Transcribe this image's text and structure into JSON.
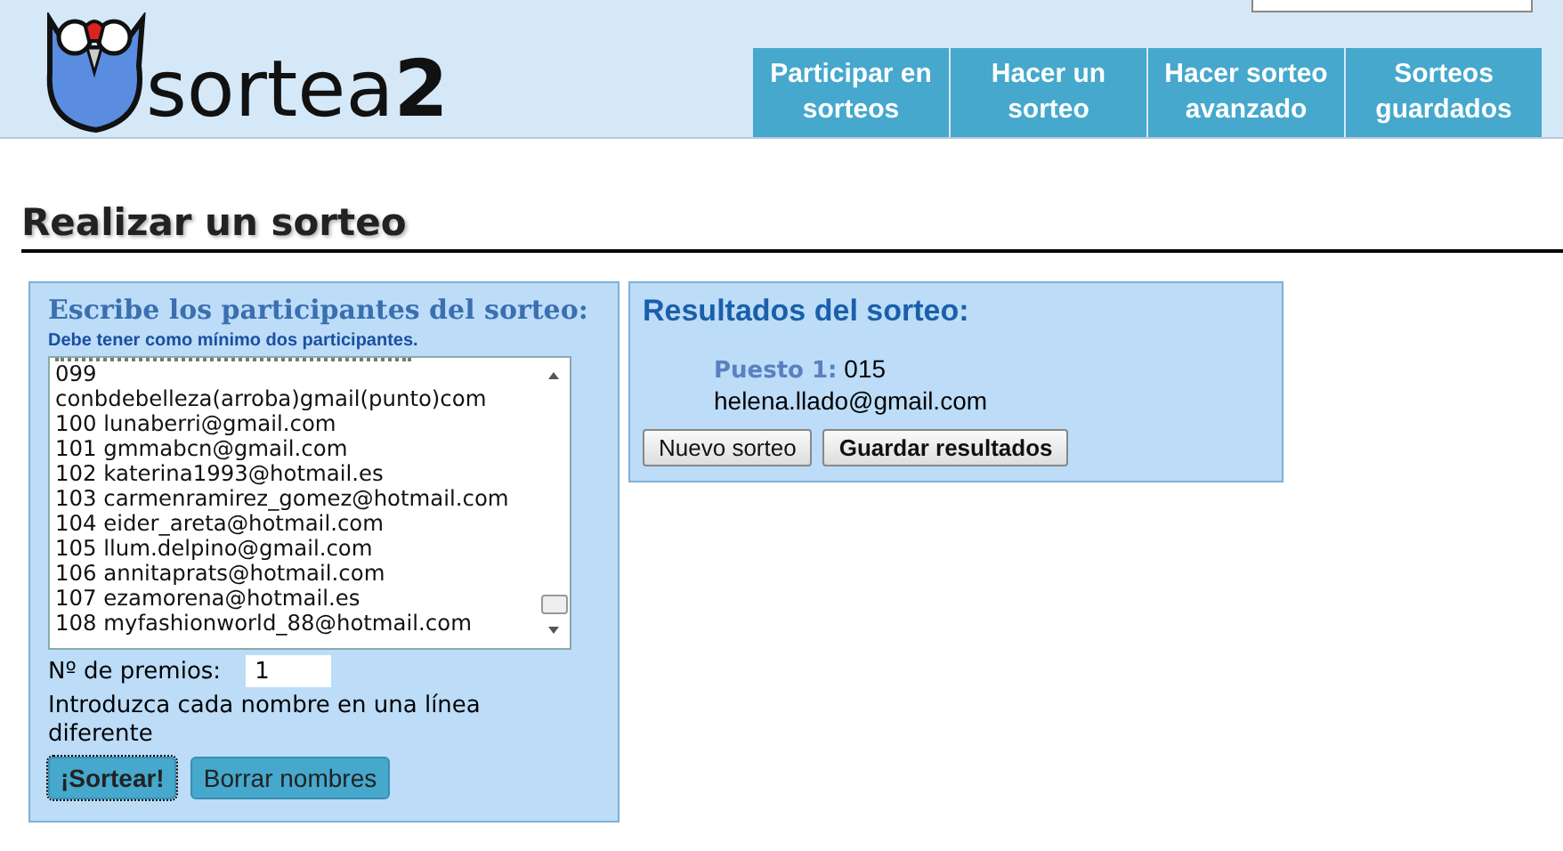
{
  "logo": {
    "text": "sortea",
    "suffix": "2"
  },
  "nav": [
    {
      "label": "Participar en sorteos"
    },
    {
      "label": "Hacer un sorteo"
    },
    {
      "label": "Hacer sorteo avanzado"
    },
    {
      "label": "Sorteos guardados"
    }
  ],
  "title": "Realizar un sorteo",
  "participants_panel": {
    "heading": "Escribe los participantes del sorteo:",
    "hint": "Debe tener como mínimo dos participantes.",
    "lines": [
      "099",
      "conbdebelleza(arroba)gmail(punto)com",
      "100 lunaberri@gmail.com",
      "101 gmmabcn@gmail.com",
      "102 katerina1993@hotmail.es",
      "103 carmenramirez_gomez@hotmail.com",
      "104 eider_areta@hotmail.com",
      "105 llum.delpino@gmail.com",
      "106 annitaprats@hotmail.com",
      "107 ezamorena@hotmail.es",
      "108 myfashionworld_88@hotmail.com"
    ],
    "prizes_label": "Nº de premios:",
    "prizes_value": "1",
    "instructions": "Introduzca cada nombre en una línea diferente",
    "buttons": [
      {
        "label": "¡Sortear!",
        "kind": "primary"
      },
      {
        "label": "Borrar nombres",
        "kind": "secondary"
      }
    ]
  },
  "results_panel": {
    "heading": "Resultados del sorteo:",
    "results": [
      {
        "place": "Puesto 1:",
        "number": "015",
        "name": "helena.llado@gmail.com"
      }
    ],
    "buttons": [
      {
        "label": "Nuevo sorteo",
        "kind": "normal"
      },
      {
        "label": "Guardar resultados",
        "kind": "bold"
      }
    ]
  }
}
